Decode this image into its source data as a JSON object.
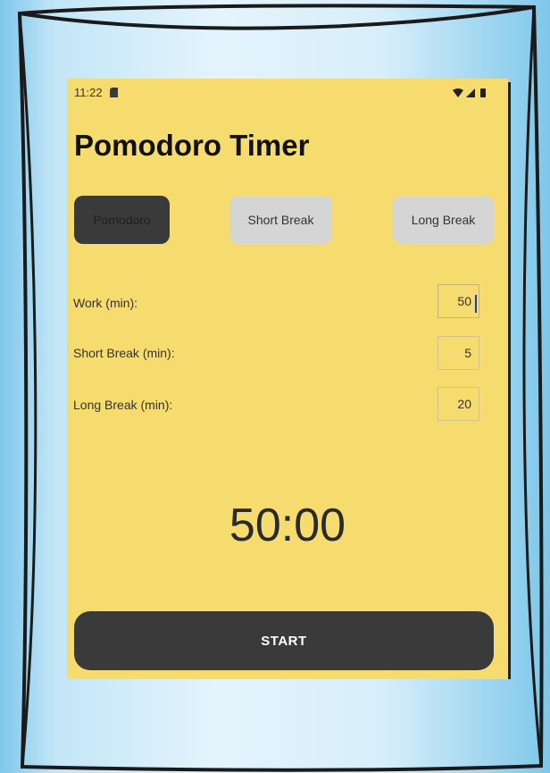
{
  "status_bar": {
    "time": "11:22"
  },
  "app": {
    "title": "Pomodoro Timer"
  },
  "modes": [
    {
      "label": "Pomodoro",
      "selected": true
    },
    {
      "label": "Short Break",
      "selected": false
    },
    {
      "label": "Long Break",
      "selected": false
    }
  ],
  "settings": [
    {
      "label": "Work (min):",
      "value": "50"
    },
    {
      "label": "Short Break (min):",
      "value": "5"
    },
    {
      "label": "Long Break (min):",
      "value": "20"
    }
  ],
  "timer": {
    "display": "50:00"
  },
  "start_button": {
    "label": "START"
  },
  "colors": {
    "screen_background": "#f6db6f",
    "active_button": "#3a3a3a",
    "inactive_button": "#d5d5d5",
    "start_button": "#3a3a3a",
    "frame": "#111111"
  },
  "icons": [
    "sim-card-icon",
    "wifi-icon",
    "signal-icon",
    "battery-icon"
  ]
}
